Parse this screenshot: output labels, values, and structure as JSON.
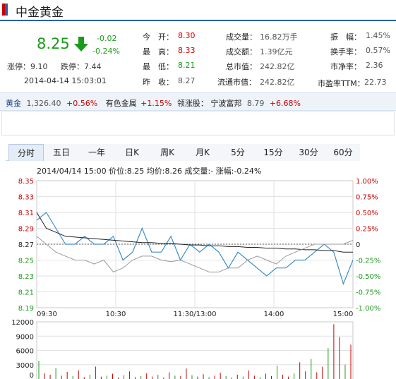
{
  "header": {
    "title": "中金黄金"
  },
  "quote": {
    "price": "8.25",
    "change": "-0.02",
    "change_pct": "-0.24%",
    "limit_up_label": "涨停：",
    "limit_up": "9.10",
    "limit_down_label": "跌停：",
    "limit_down": "7.44",
    "datetime": "2014-04-14 15:03:01",
    "fields": [
      {
        "label": "今　开：",
        "value": "8.30",
        "tone": "red"
      },
      {
        "label": "最　高：",
        "value": "8.33",
        "tone": "red"
      },
      {
        "label": "最　低：",
        "value": "8.21",
        "tone": "green"
      },
      {
        "label": "昨　收：",
        "value": "8.27",
        "tone": "gray"
      },
      {
        "label": "成交量：",
        "value": "16.82万手",
        "tone": "gray"
      },
      {
        "label": "成交额：",
        "value": "1.39亿元",
        "tone": "gray"
      },
      {
        "label": "总市值：",
        "value": "242.82亿",
        "tone": "gray"
      },
      {
        "label": "流通市值：",
        "value": "242.82亿",
        "tone": "gray"
      },
      {
        "label": "振　幅：",
        "value": "1.45%",
        "tone": "gray"
      },
      {
        "label": "换手率：",
        "value": "0.57%",
        "tone": "gray"
      },
      {
        "label": "市净率：",
        "value": "2.36",
        "tone": "gray"
      },
      {
        "label": "市盈率TTM：",
        "value": "22.73",
        "tone": "gray"
      }
    ]
  },
  "sector": {
    "item1_name": "黄金",
    "item1_value": "1,326.40",
    "item1_pct": "+0.56%",
    "item2_name": "有色金属",
    "item2_pct": "+1.15%",
    "leader_label": "领涨股：",
    "leader_name": "宁波富邦",
    "leader_value": "8.79",
    "leader_pct": "+6.68%"
  },
  "tabs": [
    "分时",
    "五日",
    "一年",
    "日K",
    "周K",
    "月K",
    "5分",
    "15分",
    "30分",
    "60分"
  ],
  "active_tab": "分时",
  "chart_info": "2014/04/14 15:00  价位:8.25  均价:8.26  成交量:-  涨幅:-0.24%",
  "colors": {
    "up": "#cc0000",
    "down": "#1a9a1a",
    "price_line": "#3a8ec8",
    "avg_line": "#222222",
    "index_line": "#999999",
    "accent": "#2c5ea8"
  },
  "chart_data": [
    {
      "type": "line",
      "title": "",
      "x": [
        "09:30",
        "10:30",
        "11:30/13:00",
        "14:00",
        "15:00"
      ],
      "y_left_ticks": [
        "8.35",
        "8.33",
        "8.31",
        "8.29",
        "8.27",
        "8.25",
        "8.23",
        "8.21",
        "8.19"
      ],
      "y_right_ticks": [
        "1.00%",
        "0.75%",
        "0.50%",
        "0.25%",
        "0",
        "-0.25%",
        "-0.50%",
        "-0.75%",
        "-1.00%"
      ],
      "ylim": [
        8.19,
        8.35
      ],
      "prev_close": 8.27,
      "series": [
        {
          "values": [
            8.3,
            8.31,
            8.29,
            8.27,
            8.27,
            8.28,
            8.27,
            8.27,
            8.28,
            8.25,
            8.26,
            8.29,
            8.26,
            8.26,
            8.28,
            8.25,
            8.27,
            8.26,
            8.27,
            8.26,
            8.24,
            8.26,
            8.25,
            8.24,
            8.23,
            8.24,
            8.24,
            8.25,
            8.25,
            8.26,
            8.27,
            8.26,
            8.22,
            8.25
          ]
        },
        {
          "values": [
            8.31,
            8.29,
            8.285,
            8.28,
            8.279,
            8.278,
            8.277,
            8.276,
            8.275,
            8.274,
            8.273,
            8.272,
            8.272,
            8.271,
            8.271,
            8.27,
            8.269,
            8.269,
            8.268,
            8.268,
            8.267,
            8.267,
            8.266,
            8.266,
            8.265,
            8.265,
            8.264,
            8.264,
            8.263,
            8.263,
            8.262,
            8.262,
            8.26,
            8.26
          ]
        },
        {
          "values": [
            8.28,
            8.27,
            8.26,
            8.255,
            8.25,
            8.25,
            8.245,
            8.25,
            8.235,
            8.24,
            8.25,
            8.255,
            8.255,
            8.25,
            8.248,
            8.25,
            8.245,
            8.24,
            8.235,
            8.235,
            8.24,
            8.24,
            8.25,
            8.255,
            8.25,
            8.245,
            8.255,
            8.26,
            8.265,
            8.27,
            8.27,
            8.27,
            8.27,
            8.275
          ]
        }
      ]
    },
    {
      "type": "bar",
      "title": "",
      "y_ticks": [
        "12000",
        "9000",
        "6000",
        "3000",
        "0"
      ],
      "ylim": [
        0,
        12000
      ],
      "values": [
        3800,
        1200,
        900,
        2300,
        700,
        1500,
        600,
        1800,
        400,
        900,
        2600,
        500,
        700,
        1100,
        300,
        800,
        1600,
        400,
        600,
        1200,
        500,
        900,
        300,
        1400,
        700,
        600,
        2200,
        800,
        500,
        1000,
        400,
        700,
        1300,
        600,
        300,
        900,
        500,
        1800,
        700,
        400,
        1100,
        600,
        2800,
        900,
        500,
        1200,
        3500,
        1600,
        4200,
        1400,
        2600,
        6500,
        11500,
        8800,
        3000,
        7200
      ]
    }
  ]
}
